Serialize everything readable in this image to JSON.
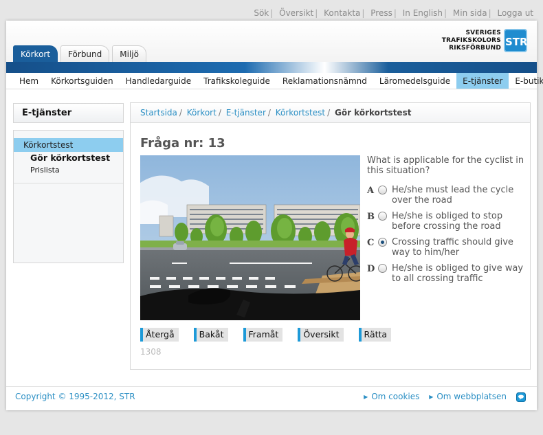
{
  "top_links": [
    "Sök",
    "Översikt",
    "Kontakta",
    "Press",
    "In English",
    "Min sida",
    "Logga ut"
  ],
  "logo": {
    "line1": "SVERIGES",
    "line2": "TRAFIKSKOLORS",
    "line3": "RIKSFÖRBUND",
    "mark": "STR"
  },
  "main_tabs": [
    "Körkort",
    "Förbund",
    "Miljö"
  ],
  "sub_nav": [
    "Hem",
    "Körkortsguiden",
    "Handledarguide",
    "Trafikskoleguide",
    "Reklamationsnämnd",
    "Läromedelsguide",
    "E-tjänster",
    "E-butik"
  ],
  "left": {
    "title": "E-tjänster",
    "section": "Körkortstest",
    "sub_active": "Gör körkortstest",
    "sub_other": "Prislista"
  },
  "breadcrumb": [
    "Startsida",
    "Körkort",
    "E-tjänster",
    "Körkortstest"
  ],
  "breadcrumb_current": "Gör körkortstest",
  "quiz": {
    "title": "Fråga nr: 13",
    "question": "What is applicable for the cyclist in this situation?",
    "answers": [
      {
        "letter": "A",
        "text": "He/she must lead the cycle over the road",
        "selected": false
      },
      {
        "letter": "B",
        "text": "He/she is obliged to stop before crossing the road",
        "selected": false
      },
      {
        "letter": "C",
        "text": "Crossing traffic should give way to him/her",
        "selected": true
      },
      {
        "letter": "D",
        "text": "He/she is obliged to give way to all crossing traffic",
        "selected": false
      }
    ],
    "buttons": [
      "Återgå",
      "Bakåt",
      "Framåt",
      "Översikt",
      "Rätta"
    ],
    "code": "1308"
  },
  "footer": {
    "copyright": "Copyright © 1995-2012, STR",
    "links": [
      "Om cookies",
      "Om webbplatsen"
    ]
  },
  "colors": {
    "brand_blue": "#1a5e9b",
    "highlight": "#8dcdef",
    "link": "#2b8fc4",
    "button_accent": "#1e9ad8"
  }
}
